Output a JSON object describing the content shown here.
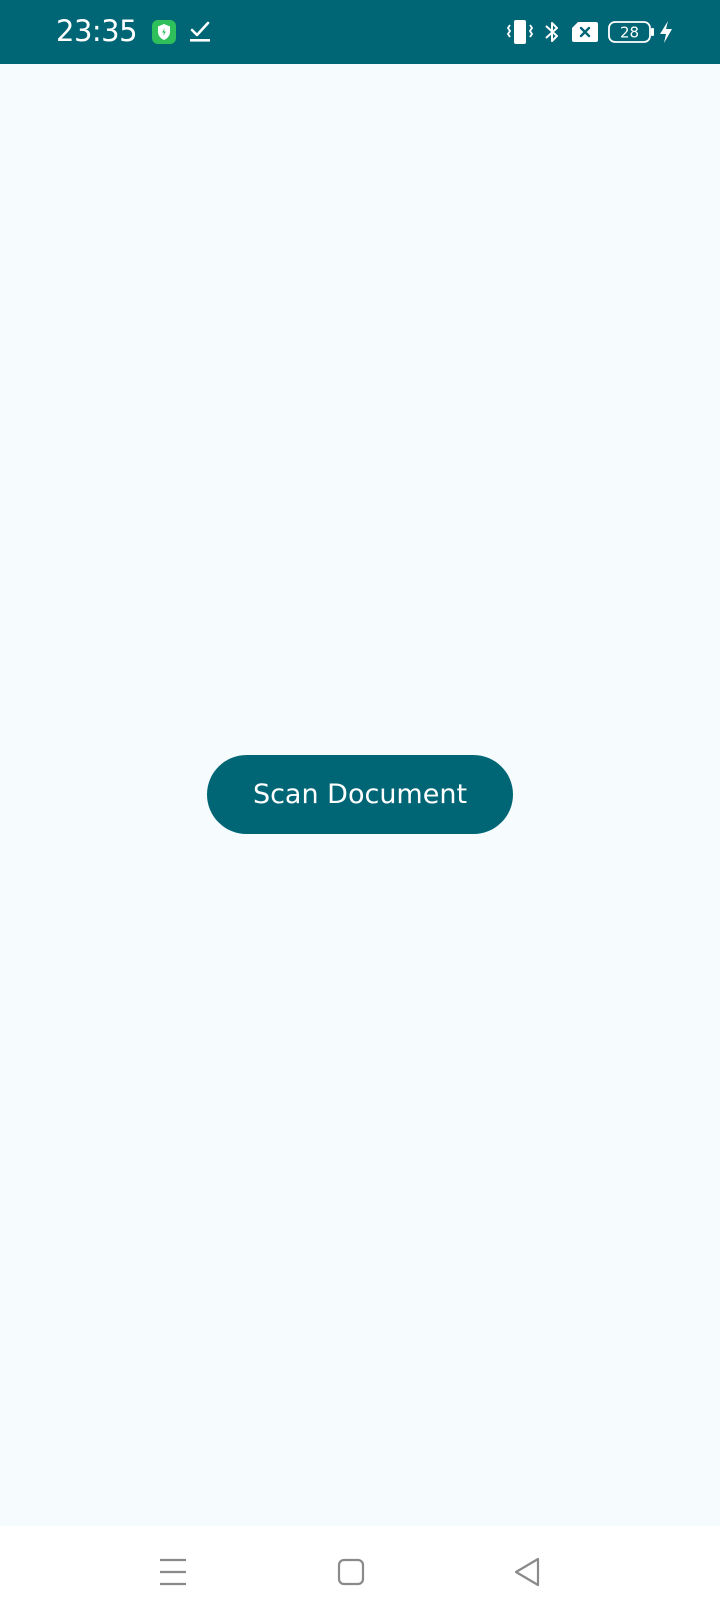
{
  "status_bar": {
    "time": "23:35",
    "battery_level": "28",
    "icons": [
      "shield-app-icon",
      "check-icon",
      "vibrate-icon",
      "bluetooth-icon",
      "no-sim-icon",
      "battery-icon",
      "charging-icon"
    ]
  },
  "main": {
    "scan_button_label": "Scan Document"
  },
  "navigation": {
    "icons": [
      "recents-menu-icon",
      "home-icon",
      "back-icon"
    ]
  },
  "colors": {
    "primary": "#006675",
    "background": "#f6fcfd",
    "on_primary": "#ffffff"
  }
}
